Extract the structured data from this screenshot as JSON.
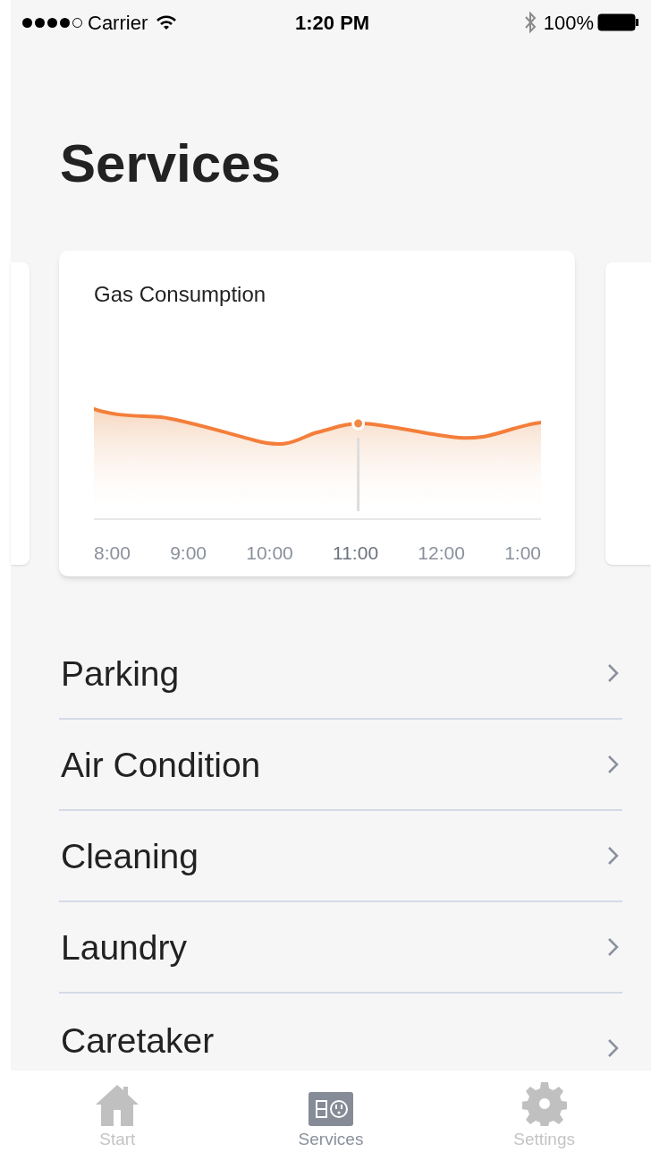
{
  "status_bar": {
    "carrier": "Carrier",
    "time": "1:20 PM",
    "battery": "100%"
  },
  "title": "Services",
  "card": {
    "title": "Gas Consumption",
    "x_labels": [
      {
        "label": "8:00",
        "selected": false
      },
      {
        "label": "9:00",
        "selected": false
      },
      {
        "label": "10:00",
        "selected": false
      },
      {
        "label": "11:00",
        "selected": true
      },
      {
        "label": "12:00",
        "selected": false
      },
      {
        "label": "1:00",
        "selected": false
      }
    ]
  },
  "services": [
    {
      "label": "Parking"
    },
    {
      "label": "Air Condition"
    },
    {
      "label": "Cleaning"
    },
    {
      "label": "Laundry"
    },
    {
      "label": "Caretaker"
    }
  ],
  "tabs": [
    {
      "label": "Start",
      "selected": false
    },
    {
      "label": "Services",
      "selected": true
    },
    {
      "label": "Settings",
      "selected": false
    }
  ]
}
